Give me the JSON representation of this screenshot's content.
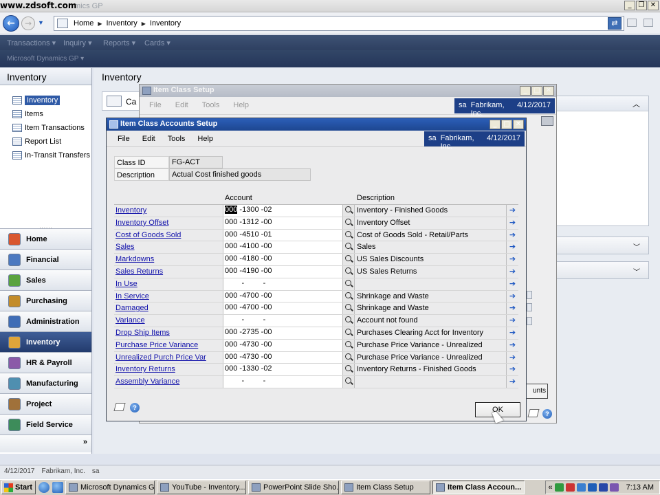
{
  "watermark": "www.zdsoft.com",
  "app_title": "Microsoft Dynamics GP",
  "app_title_visible": "mics GP",
  "breadcrumb": [
    "Home",
    "Inventory",
    "Inventory"
  ],
  "top_menu": [
    "Transactions",
    "Inquiry",
    "Reports",
    "Cards"
  ],
  "site_label": "Microsoft Dynamics GP",
  "nav": {
    "header": "Inventory",
    "links": [
      "Inventory",
      "Items",
      "Item Transactions",
      "Report List",
      "In-Transit Transfers"
    ],
    "selected_link": "Inventory",
    "grip": "......",
    "buttons": [
      {
        "label": "Home",
        "color": "#d9572f"
      },
      {
        "label": "Financial",
        "color": "#4c79c0"
      },
      {
        "label": "Sales",
        "color": "#5aa33f"
      },
      {
        "label": "Purchasing",
        "color": "#c38c2a"
      },
      {
        "label": "Administration",
        "color": "#3f6db6"
      },
      {
        "label": "Inventory",
        "color": "#e0a53a"
      },
      {
        "label": "HR & Payroll",
        "color": "#8b5aa8"
      },
      {
        "label": "Manufacturing",
        "color": "#4f8fb0"
      },
      {
        "label": "Project",
        "color": "#a0713a"
      },
      {
        "label": "Field Service",
        "color": "#3d8c5a"
      }
    ],
    "active_button": "Inventory",
    "more": "»"
  },
  "main": {
    "title": "Inventory",
    "card_label": "Ca"
  },
  "status": {
    "date": "4/12/2017",
    "company": "Fabrikam, Inc.",
    "user": "sa"
  },
  "item_class_setup": {
    "title": "Item Class Setup",
    "menu": [
      "File",
      "Edit",
      "Tools",
      "Help"
    ],
    "user": "sa",
    "company": "Fabrikam, Inc.",
    "date": "4/12/2017",
    "button_partial": "unts"
  },
  "item_class_accounts_setup": {
    "title": "Item Class Accounts Setup",
    "menu": [
      "File",
      "Edit",
      "Tools",
      "Help"
    ],
    "user": "sa",
    "company": "Fabrikam, Inc.",
    "date": "4/12/2017",
    "class_id_label": "Class ID",
    "class_id": "FG-ACT",
    "description_label": "Description",
    "description": "Actual Cost finished goods",
    "col_account": "Account",
    "col_description": "Description",
    "ok_label": "OK",
    "rows": [
      {
        "name": "Inventory",
        "s1": "000",
        "s2": "1300",
        "s3": "02",
        "desc": "Inventory - Finished Goods"
      },
      {
        "name": "Inventory Offset",
        "s1": "000",
        "s2": "1312",
        "s3": "00",
        "desc": "Inventory Offset"
      },
      {
        "name": "Cost of Goods Sold",
        "s1": "000",
        "s2": "4510",
        "s3": "01",
        "desc": "Cost of Goods Sold - Retail/Parts"
      },
      {
        "name": "Sales",
        "s1": "000",
        "s2": "4100",
        "s3": "00",
        "desc": "Sales"
      },
      {
        "name": "Markdowns",
        "s1": "000",
        "s2": "4180",
        "s3": "00",
        "desc": "US Sales Discounts"
      },
      {
        "name": "Sales Returns",
        "s1": "000",
        "s2": "4190",
        "s3": "00",
        "desc": "US Sales Returns"
      },
      {
        "name": "In Use",
        "s1": "",
        "s2": "",
        "s3": "",
        "desc": ""
      },
      {
        "name": "In Service",
        "s1": "000",
        "s2": "4700",
        "s3": "00",
        "desc": "Shrinkage and Waste"
      },
      {
        "name": "Damaged",
        "s1": "000",
        "s2": "4700",
        "s3": "00",
        "desc": "Shrinkage and Waste"
      },
      {
        "name": "Variance",
        "s1": "",
        "s2": "",
        "s3": "",
        "desc": "Account not found"
      },
      {
        "name": "Drop Ship Items",
        "s1": "000",
        "s2": "2735",
        "s3": "00",
        "desc": "Purchases Clearing Acct for Inventory"
      },
      {
        "name": "Purchase Price Variance",
        "s1": "000",
        "s2": "4730",
        "s3": "00",
        "desc": "Purchase Price Variance - Unrealized"
      },
      {
        "name": "Unrealized Purch Price Var",
        "s1": "000",
        "s2": "4730",
        "s3": "00",
        "desc": "Purchase Price Variance - Unrealized"
      },
      {
        "name": "Inventory Returns",
        "s1": "000",
        "s2": "1330",
        "s3": "02",
        "desc": "Inventory Returns - Finished Goods"
      },
      {
        "name": "Assembly Variance",
        "s1": "",
        "s2": "",
        "s3": "",
        "desc": ""
      }
    ]
  },
  "taskbar": {
    "start": "Start",
    "tasks": [
      {
        "label": "Microsoft Dynamics GP",
        "active": false
      },
      {
        "label": "YouTube - Inventory...",
        "active": false
      },
      {
        "label": "PowerPoint Slide Sho...",
        "active": false
      },
      {
        "label": "Item Class Setup",
        "active": false
      },
      {
        "label": "Item Class Accoun...",
        "active": true
      }
    ],
    "tray_arrow": "«",
    "clock": "7:13 AM"
  }
}
